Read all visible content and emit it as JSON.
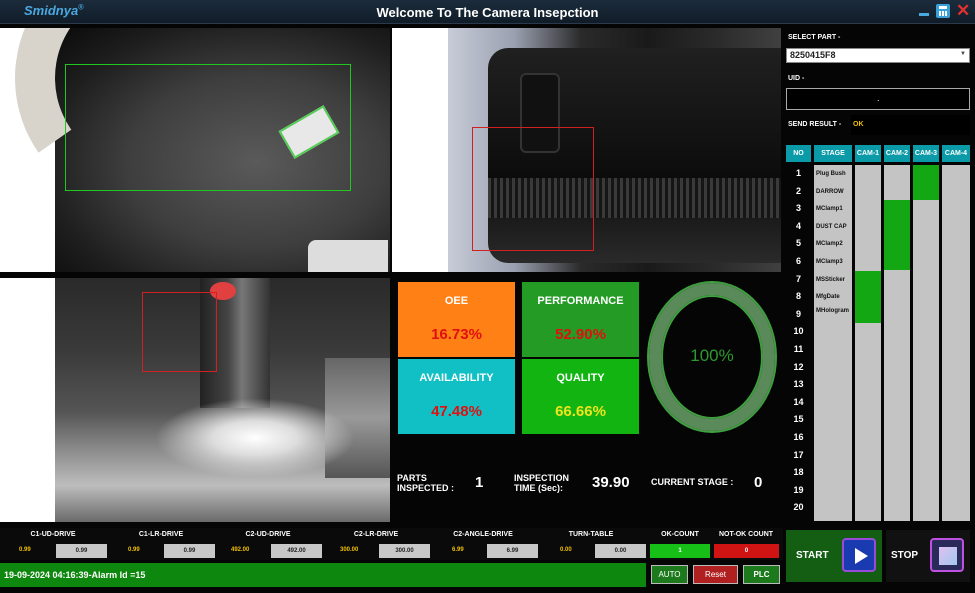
{
  "app": {
    "logo": "Smidnya",
    "logo_mark": "®",
    "title": "Welcome To The Camera Insepction"
  },
  "kpi": {
    "oee": {
      "label": "OEE",
      "value": "16.73%"
    },
    "performance": {
      "label": "PERFORMANCE",
      "value": "52.90%"
    },
    "availability": {
      "label": "AVAILABILITY",
      "value": "47.48%"
    },
    "quality": {
      "label": "QUALITY",
      "value": "66.66%"
    }
  },
  "gauge": {
    "value": "100%"
  },
  "stats": {
    "parts_label_1": "PARTS",
    "parts_label_2": "INSPECTED :",
    "parts_value": "1",
    "time_label_1": "INSPECTION",
    "time_label_2": "TIME (Sec):",
    "time_value": "39.90",
    "stage_label": "CURRENT STAGE :",
    "stage_value": "0"
  },
  "right_panel": {
    "select_part_label": "SELECT PART -",
    "select_part_value": "8250415F8",
    "uid_label": "UID -",
    "uid_value": ".",
    "send_result_label": "SEND RESULT -",
    "send_result_value": "OK"
  },
  "grid": {
    "headers": [
      "NO",
      "STAGE",
      "CAM-1",
      "CAM-2",
      "CAM-3",
      "CAM-4"
    ],
    "numbers": [
      "1",
      "2",
      "3",
      "4",
      "5",
      "6",
      "7",
      "8",
      "9",
      "10",
      "11",
      "12",
      "13",
      "14",
      "15",
      "16",
      "17",
      "18",
      "19",
      "20"
    ],
    "stages": [
      "Plug Bush",
      "DARROW",
      "MClamp1",
      "DUST CAP",
      "MClamp2",
      "MClamp3",
      "MSSticker",
      "MfgDate",
      "MHologram"
    ],
    "pass_color": "#13a813"
  },
  "drives": [
    {
      "label": "C1-UD-DRIVE",
      "value": "0.99",
      "box": "0.99"
    },
    {
      "label": "C1-LR-DRIVE",
      "value": "0.99",
      "box": "0.99"
    },
    {
      "label": "C2-UD-DRIVE",
      "value": "492.00",
      "box": "492.00"
    },
    {
      "label": "C2-LR-DRIVE",
      "value": "300.00",
      "box": "300.00"
    },
    {
      "label": "C2-ANGLE-DRIVE",
      "value": "6.99",
      "box": "6.99"
    },
    {
      "label": "TURN-TABLE",
      "value": "0.00",
      "box": "0.00"
    }
  ],
  "counts": {
    "ok_label": "OK-COUNT",
    "ok_value": "1",
    "notok_label": "NOT-OK COUNT",
    "notok_value": "0"
  },
  "status": {
    "message": "19-09-2024 04:16:39-Alarm Id =15"
  },
  "buttons": {
    "auto": "AUTO",
    "reset": "Reset",
    "plc": "PLC",
    "start": "START",
    "stop": "STOP"
  }
}
